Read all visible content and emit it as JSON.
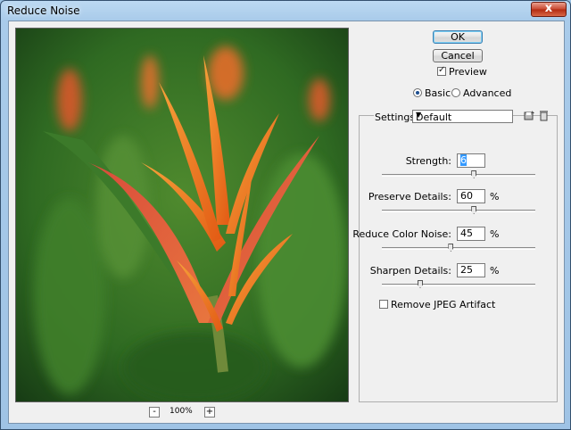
{
  "window": {
    "title": "Reduce Noise",
    "close_label": "x"
  },
  "buttons": {
    "ok": "OK",
    "cancel": "Cancel"
  },
  "preview": {
    "label": "Preview",
    "checked": true,
    "zoom_out": "-",
    "zoom_in": "+",
    "zoom": "100%"
  },
  "mode": {
    "basic": "Basic",
    "advanced": "Advanced",
    "selected": "basic"
  },
  "settings": {
    "label": "Settings:",
    "value": "Default",
    "icons": [
      "save-settings-icon",
      "delete-settings-icon"
    ]
  },
  "params": [
    {
      "label": "Strength:",
      "value": "6",
      "unit": "",
      "fraction": 0.6
    },
    {
      "label": "Preserve Details:",
      "value": "60",
      "unit": "%",
      "fraction": 0.6
    },
    {
      "label": "Reduce Color Noise:",
      "value": "45",
      "unit": "%",
      "fraction": 0.45
    },
    {
      "label": "Sharpen Details:",
      "value": "25",
      "unit": "%",
      "fraction": 0.25
    }
  ],
  "jpeg": {
    "label": "Remove JPEG Artifact",
    "checked": false
  },
  "colors": {
    "accent": "#3399ff",
    "title_bar": "#a9cbea",
    "panel": "#f0f0f0"
  }
}
